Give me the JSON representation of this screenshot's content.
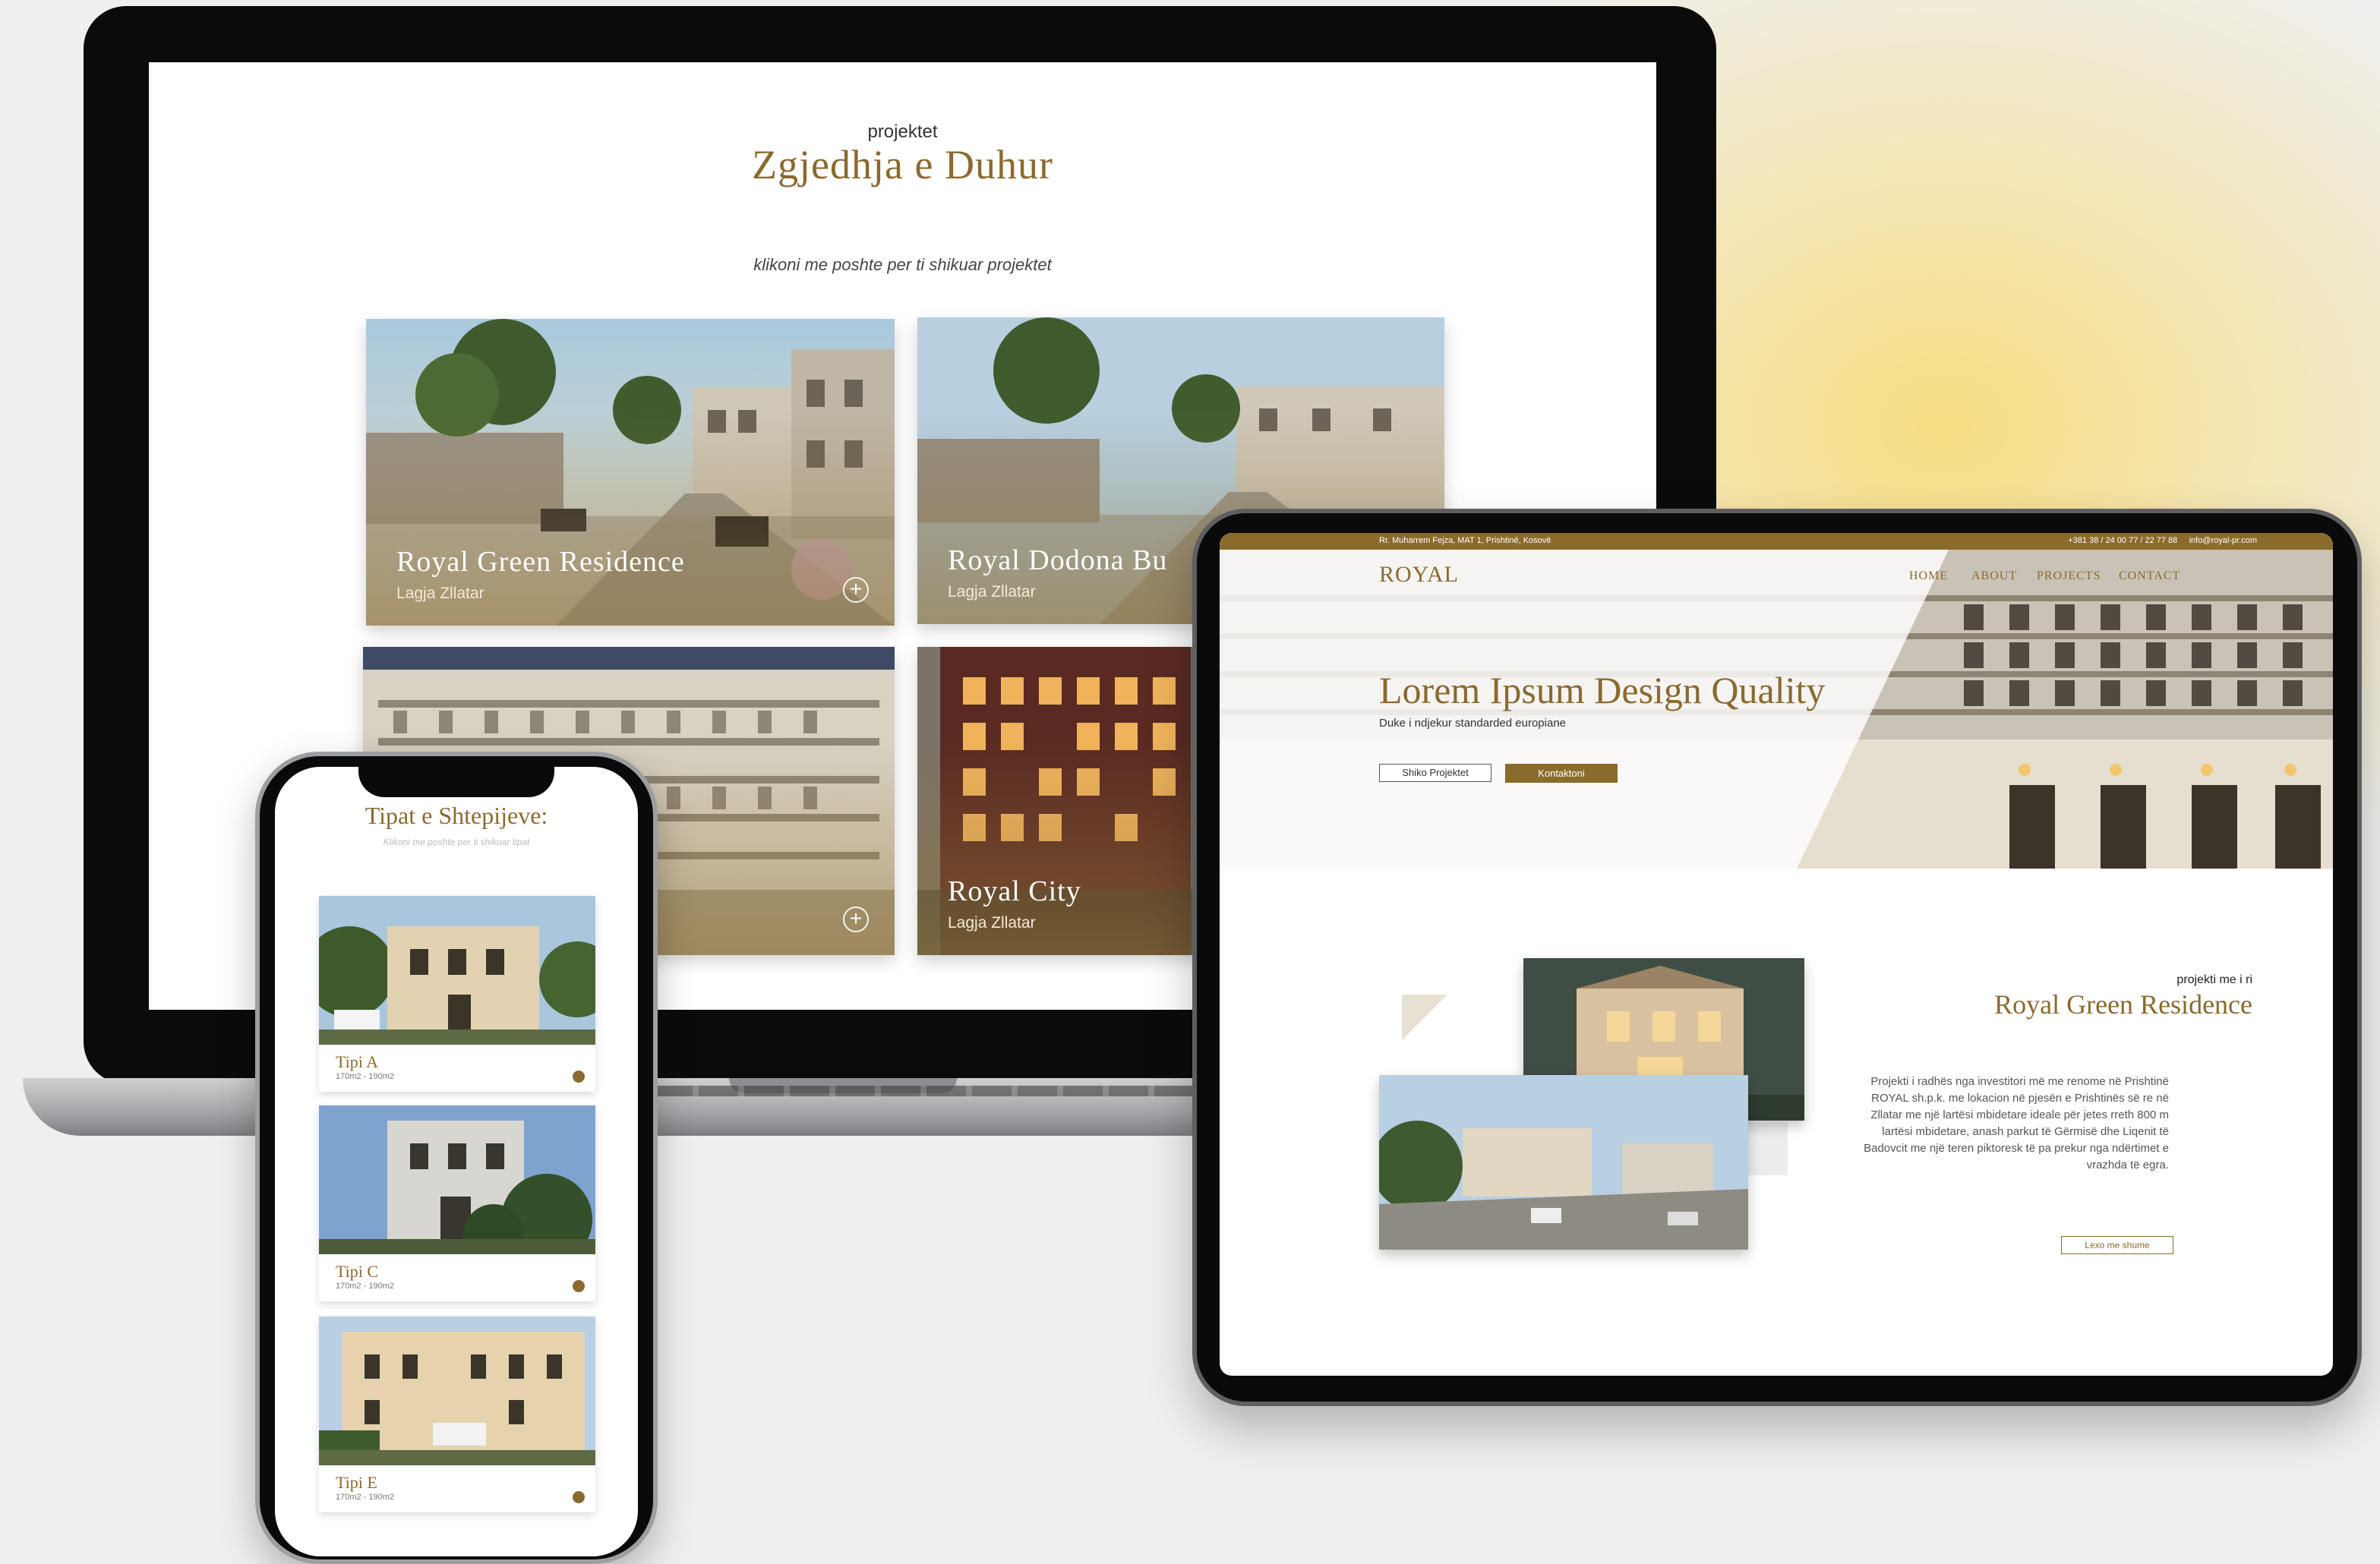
{
  "laptop": {
    "eyebrow": "projektet",
    "heading": "Zgjedhja e Duhur",
    "subtext": "klikoni me poshte per ti shikuar projektet",
    "projects": [
      {
        "name": "Royal Green Residence",
        "location": "Lagja Zllatar"
      },
      {
        "name": "Royal Dodona Bu",
        "location": "Lagja Zllatar"
      },
      {
        "name": "",
        "location": ""
      },
      {
        "name": "Royal City",
        "location": "Lagja Zllatar"
      }
    ]
  },
  "tablet": {
    "topbar_left": "Rr. Muharrem Fejza, MAT 1, Prishtinë, Kosovë",
    "topbar_right": "+381 38 / 24 00 77 / 22 77 88     info@royal-pr.com",
    "logo": "ROYAL",
    "nav": [
      "HOME",
      "ABOUT",
      "PROJECTS",
      "CONTACT"
    ],
    "hero_title": "Lorem Ipsum Design Quality",
    "hero_subtitle": "Duke i ndjekur standarded europiane",
    "btn_projects": "Shiko Projektet",
    "btn_contact": "Kontaktoni",
    "section_eyebrow": "projekti me i ri",
    "section_title": "Royal Green Residence",
    "section_body": "Projekti i radhës nga investitori më me renome në Prishtinë ROYAL sh.p.k. me lokacion në pjesën e Prishtinës së re në Zllatar me një lartësi mbidetare ideale për jetes rreth 800 m lartësi mbidetare, anash parkut të Gërmisë dhe Liqenit të Badovcit me një teren piktoresk të pa prekur nga ndërtimet e vrazhda të egra.",
    "read_more": "Lexo me shume"
  },
  "phone": {
    "heading": "Tipat e Shtepijeve:",
    "subtext": "Klikoni me poshte per ti shikuar tipat",
    "types": [
      {
        "name": "Tipi A",
        "size": "170m2 - 190m2"
      },
      {
        "name": "Tipi C",
        "size": "170m2 - 190m2"
      },
      {
        "name": "Tipi E",
        "size": "170m2 - 190m2"
      }
    ]
  },
  "colors": {
    "gold": "#8a6a2e",
    "gold_button": "#8b6b2c",
    "background_glow": "#f7dd82"
  }
}
